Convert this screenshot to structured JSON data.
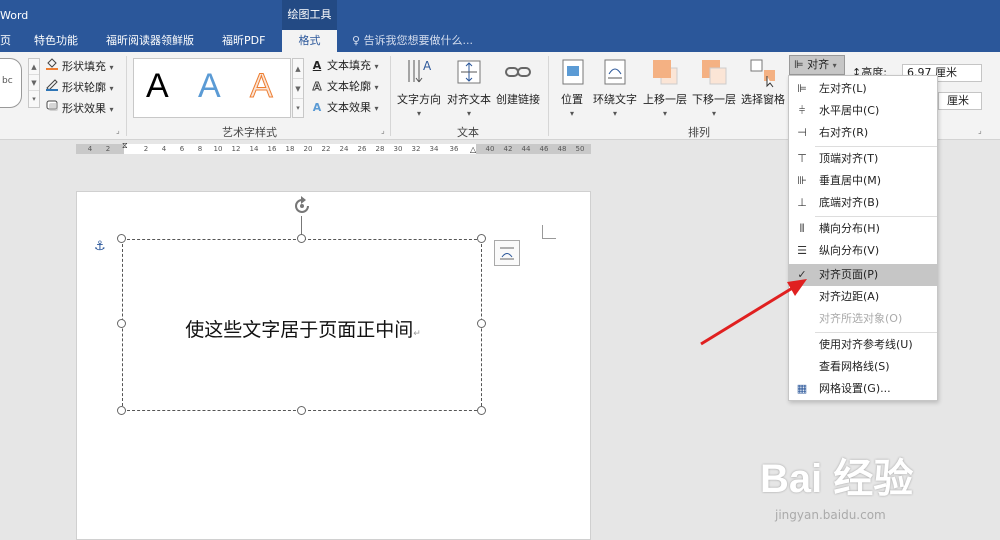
{
  "titlebar": {
    "app_title": "Word",
    "context_tool": "绘图工具"
  },
  "tabs": [
    {
      "label": "页"
    },
    {
      "label": "特色功能"
    },
    {
      "label": "福昕阅读器领鲜版"
    },
    {
      "label": "福昕PDF"
    },
    {
      "label": "格式",
      "active": true
    }
  ],
  "tell_me": {
    "text": "告诉我您想要做什么..."
  },
  "shape_styles": {
    "fill": "形状填充",
    "outline": "形状轮廓",
    "effects": "形状效果",
    "preview_text": "bc"
  },
  "wordart": {
    "group_label": "艺术字样式",
    "sample": "A",
    "text_fill": "文本填充",
    "text_outline": "文本轮廓",
    "text_effects": "文本效果"
  },
  "text_group": {
    "group_label": "文本",
    "direction": "文字方向",
    "align_text": "对齐文本",
    "create_link": "创建链接"
  },
  "arrange_group": {
    "group_label": "排列",
    "position": "位置",
    "wrap_text": "环绕文字",
    "bring_forward": "上移一层",
    "send_backward": "下移一层",
    "selection_pane": "选择窗格",
    "align": "对齐"
  },
  "size_group": {
    "height_label": "高度:",
    "height_value": "6.97 厘米",
    "width_value": "厘米"
  },
  "ruler": {
    "ticks": [
      "4",
      "2",
      "2",
      "4",
      "6",
      "8",
      "10",
      "12",
      "14",
      "16",
      "18",
      "20",
      "22",
      "24",
      "26",
      "28",
      "30",
      "32",
      "34",
      "36",
      "40",
      "42",
      "44",
      "46",
      "48",
      "50"
    ]
  },
  "document": {
    "textbox_text": "使这些文字居于页面正中间",
    "paragraph_mark": "↵"
  },
  "align_menu": {
    "items": [
      {
        "label": "左对齐(L)",
        "icon": "align-left-icon"
      },
      {
        "label": "水平居中(C)",
        "icon": "align-center-icon"
      },
      {
        "label": "右对齐(R)",
        "icon": "align-right-icon"
      },
      {
        "label": "顶端对齐(T)",
        "icon": "align-top-icon"
      },
      {
        "label": "垂直居中(M)",
        "icon": "align-middle-icon"
      },
      {
        "label": "底端对齐(B)",
        "icon": "align-bottom-icon"
      },
      {
        "label": "横向分布(H)",
        "icon": "distribute-horizontal-icon"
      },
      {
        "label": "纵向分布(V)",
        "icon": "distribute-vertical-icon"
      },
      {
        "label": "对齐页面(P)",
        "icon": "checkmark-icon",
        "checked": true
      },
      {
        "label": "对齐边距(A)"
      },
      {
        "label": "对齐所选对象(O)",
        "disabled": true
      },
      {
        "label": "使用对齐参考线(U)"
      },
      {
        "label": "查看网格线(S)"
      },
      {
        "label": "网格设置(G)...",
        "icon": "grid-icon"
      }
    ]
  },
  "watermark": {
    "brand": "Bai 经验",
    "url": "jingyan.baidu.com"
  },
  "colors": {
    "title_bar": "#2b579a",
    "arrow": "#e02020",
    "menu_highlight": "#c6c6c6"
  }
}
